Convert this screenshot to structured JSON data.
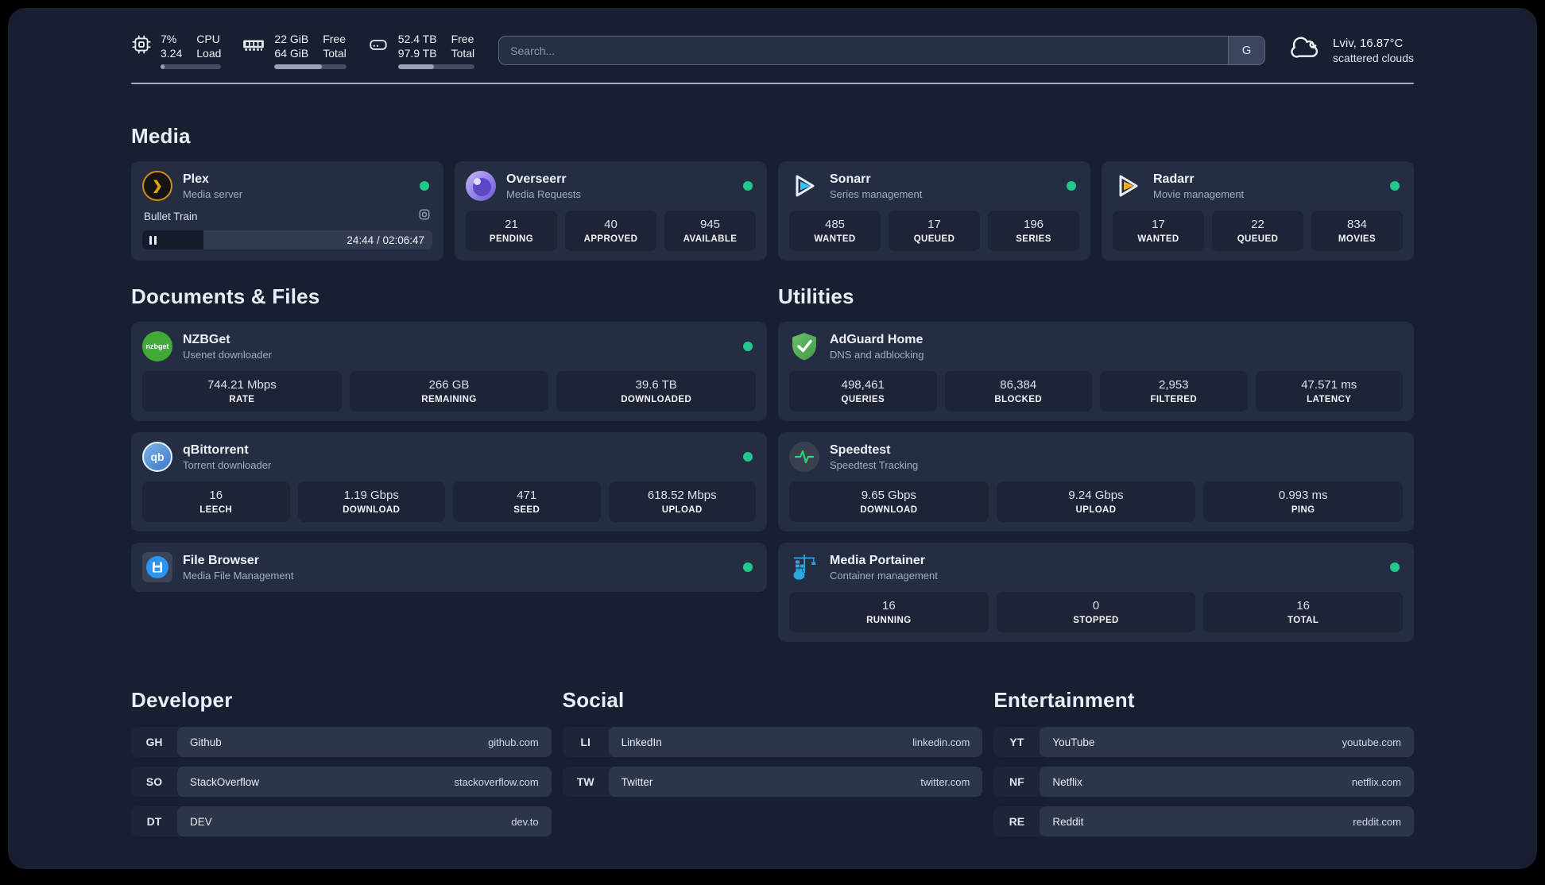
{
  "topbar": {
    "system_stats": [
      {
        "name": "cpu",
        "values": [
          "7%",
          "3.24"
        ],
        "labels": [
          "CPU",
          "Load"
        ],
        "progress": 7
      },
      {
        "name": "memory",
        "values": [
          "22 GiB",
          "64 GiB"
        ],
        "labels": [
          "Free",
          "Total"
        ],
        "progress": 66
      },
      {
        "name": "storage",
        "values": [
          "52.4 TB",
          "97.9 TB"
        ],
        "labels": [
          "Free",
          "Total"
        ],
        "progress": 47
      }
    ],
    "search": {
      "placeholder": "Search...",
      "engine_button": "G"
    },
    "weather": {
      "location_temperature": "Lviv, 16.87°C",
      "condition": "scattered clouds"
    }
  },
  "media": {
    "title": "Media",
    "cards": {
      "plex": {
        "name": "Plex",
        "description": "Media server",
        "status": "online",
        "player": {
          "title": "Bullet Train",
          "time": "24:44 / 02:06:47",
          "progress_percent": 21
        }
      },
      "overseerr": {
        "name": "Overseerr",
        "description": "Media Requests",
        "status": "online",
        "stats": [
          {
            "value": "21",
            "label": "PENDING"
          },
          {
            "value": "40",
            "label": "APPROVED"
          },
          {
            "value": "945",
            "label": "AVAILABLE"
          }
        ]
      },
      "sonarr": {
        "name": "Sonarr",
        "description": "Series management",
        "status": "online",
        "stats": [
          {
            "value": "485",
            "label": "WANTED"
          },
          {
            "value": "17",
            "label": "QUEUED"
          },
          {
            "value": "196",
            "label": "SERIES"
          }
        ]
      },
      "radarr": {
        "name": "Radarr",
        "description": "Movie management",
        "status": "online",
        "stats": [
          {
            "value": "17",
            "label": "WANTED"
          },
          {
            "value": "22",
            "label": "QUEUED"
          },
          {
            "value": "834",
            "label": "MOVIES"
          }
        ]
      }
    }
  },
  "documents": {
    "title": "Documents & Files",
    "cards": {
      "nzbget": {
        "name": "NZBGet",
        "description": "Usenet downloader",
        "status": "online",
        "icon_text": "nzbget",
        "stats": [
          {
            "value": "744.21 Mbps",
            "label": "RATE"
          },
          {
            "value": "266 GB",
            "label": "REMAINING"
          },
          {
            "value": "39.6 TB",
            "label": "DOWNLOADED"
          }
        ]
      },
      "qbittorrent": {
        "name": "qBittorrent",
        "description": "Torrent downloader",
        "status": "online",
        "icon_text": "qb",
        "stats": [
          {
            "value": "16",
            "label": "LEECH"
          },
          {
            "value": "1.19 Gbps",
            "label": "DOWNLOAD"
          },
          {
            "value": "471",
            "label": "SEED"
          },
          {
            "value": "618.52 Mbps",
            "label": "UPLOAD"
          }
        ]
      },
      "filebrowser": {
        "name": "File Browser",
        "description": "Media File Management",
        "status": "online"
      }
    }
  },
  "utilities": {
    "title": "Utilities",
    "cards": {
      "adguard": {
        "name": "AdGuard Home",
        "description": "DNS and adblocking",
        "stats": [
          {
            "value": "498,461",
            "label": "QUERIES"
          },
          {
            "value": "86,384",
            "label": "BLOCKED"
          },
          {
            "value": "2,953",
            "label": "FILTERED"
          },
          {
            "value": "47.571 ms",
            "label": "LATENCY"
          }
        ]
      },
      "speedtest": {
        "name": "Speedtest",
        "description": "Speedtest Tracking",
        "stats": [
          {
            "value": "9.65 Gbps",
            "label": "DOWNLOAD"
          },
          {
            "value": "9.24 Gbps",
            "label": "UPLOAD"
          },
          {
            "value": "0.993 ms",
            "label": "PING"
          }
        ]
      },
      "portainer": {
        "name": "Media Portainer",
        "description": "Container management",
        "status": "online",
        "stats": [
          {
            "value": "16",
            "label": "RUNNING"
          },
          {
            "value": "0",
            "label": "STOPPED"
          },
          {
            "value": "16",
            "label": "TOTAL"
          }
        ]
      }
    }
  },
  "bookmarks": {
    "developer": {
      "title": "Developer",
      "items": [
        {
          "abbr": "GH",
          "name": "Github",
          "url": "github.com"
        },
        {
          "abbr": "SO",
          "name": "StackOverflow",
          "url": "stackoverflow.com"
        },
        {
          "abbr": "DT",
          "name": "DEV",
          "url": "dev.to"
        }
      ]
    },
    "social": {
      "title": "Social",
      "items": [
        {
          "abbr": "LI",
          "name": "LinkedIn",
          "url": "linkedin.com"
        },
        {
          "abbr": "TW",
          "name": "Twitter",
          "url": "twitter.com"
        }
      ]
    },
    "entertainment": {
      "title": "Entertainment",
      "items": [
        {
          "abbr": "YT",
          "name": "YouTube",
          "url": "youtube.com"
        },
        {
          "abbr": "NF",
          "name": "Netflix",
          "url": "netflix.com"
        },
        {
          "abbr": "RE",
          "name": "Reddit",
          "url": "reddit.com"
        }
      ]
    }
  },
  "colors": {
    "status_online": "#1fc98c",
    "plex_accent": "#e5a00d",
    "sonarr_accent": "#35c5f4",
    "radarr_accent": "#f7a823",
    "nzbget_green": "#3faa36",
    "qbittorrent_blue": "#4b8fd5",
    "adguard_green": "#55b257",
    "speedtest_green": "#2fd27e",
    "portainer_blue": "#29a8df"
  }
}
